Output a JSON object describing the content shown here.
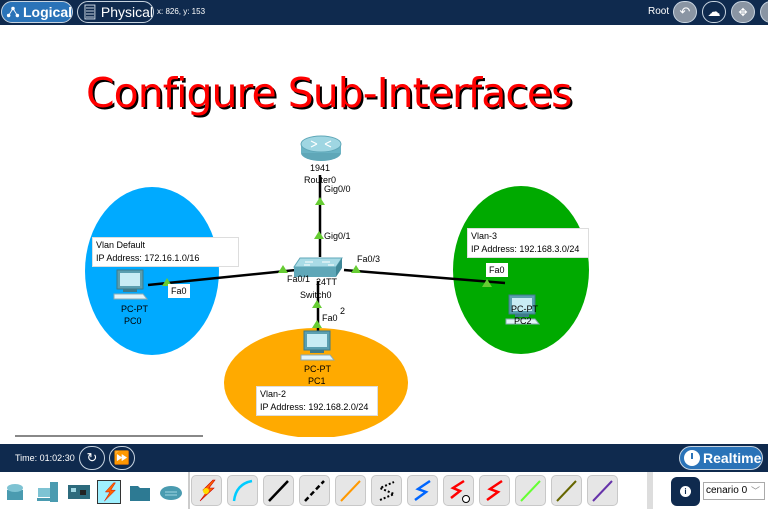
{
  "topbar": {
    "logical_label": "Logical",
    "physical_label": "Physical",
    "coords": "x: 826, y: 153",
    "root_label": "Root"
  },
  "canvas": {
    "title": "Configure Sub-Interfaces",
    "router": {
      "model": "1941",
      "name": "Router0",
      "port_down": "Gig0/0"
    },
    "switch": {
      "model": "2960-24TT",
      "model_visible": "24TT",
      "name": "Switch0",
      "port_up": "Gig0/1",
      "port_left": "Fa0/1",
      "port_right": "Fa0/3",
      "port_down_suffix": "2"
    },
    "pcs": [
      {
        "type": "PC-PT",
        "name": "PC0",
        "port": "Fa0",
        "vlan_label": "Vlan Default",
        "ip_label": "IP Address: 172.16.1.0/16",
        "zone_color": "#00aaff"
      },
      {
        "type": "PC-PT",
        "name": "PC1",
        "port": "Fa0",
        "vlan_label": "Vlan-2",
        "ip_label": "IP Address: 192.168.2.0/24",
        "zone_color": "#ffaa00"
      },
      {
        "type": "PC-PT",
        "name": "PC2",
        "port": "Fa0",
        "vlan_label": "Vlan-3",
        "ip_label": "IP Address: 192.168.3.0/24",
        "zone_color": "#00aa00"
      }
    ],
    "link_color": "#000000",
    "link_light_color": "#66cc33"
  },
  "timebar": {
    "time": "Time: 01:02:30",
    "realtime_label": "Realtime"
  },
  "palette": {
    "categories": [
      "network-devices",
      "end-devices",
      "components",
      "connections",
      "miscellaneous",
      "multiuser"
    ],
    "selected_category": "connections",
    "cables": [
      {
        "name": "automatic",
        "color": "#ff6600"
      },
      {
        "name": "console",
        "color": "#00ccff"
      },
      {
        "name": "copper-straight-through",
        "color": "#000000"
      },
      {
        "name": "copper-cross-over",
        "color": "#000000"
      },
      {
        "name": "fiber",
        "color": "#ff9900"
      },
      {
        "name": "phone",
        "color": "#000000"
      },
      {
        "name": "coaxial",
        "color": "#0066ff"
      },
      {
        "name": "serial-dce",
        "color": "#ff0000"
      },
      {
        "name": "serial-dte",
        "color": "#ff0000"
      },
      {
        "name": "octal",
        "color": "#66ff33"
      },
      {
        "name": "iot-custom",
        "color": "#666600"
      },
      {
        "name": "usb",
        "color": "#6633aa"
      }
    ],
    "scenario_value": "cenario 0"
  }
}
